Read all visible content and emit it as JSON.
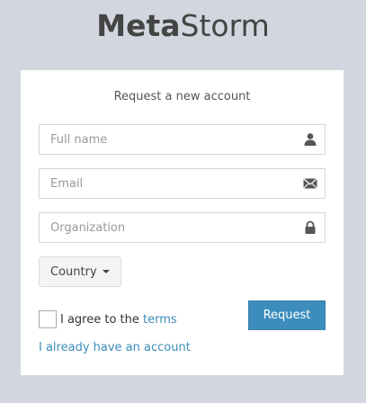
{
  "brand": {
    "bold": "Meta",
    "light": "Storm"
  },
  "form": {
    "message": "Request a new account",
    "fullname_placeholder": "Full name",
    "email_placeholder": "Email",
    "organization_placeholder": "Organization",
    "country_label": "Country",
    "agree_text": "I agree to the ",
    "terms_link": "terms",
    "request_label": "Request",
    "have_account_link": "I already have an account"
  },
  "icons": {
    "fullname": "user-icon",
    "email": "envelope-icon",
    "organization": "lock-icon",
    "country": "caret-down-icon"
  },
  "colors": {
    "background": "#d2d6de",
    "accent": "#3c8dbc"
  }
}
